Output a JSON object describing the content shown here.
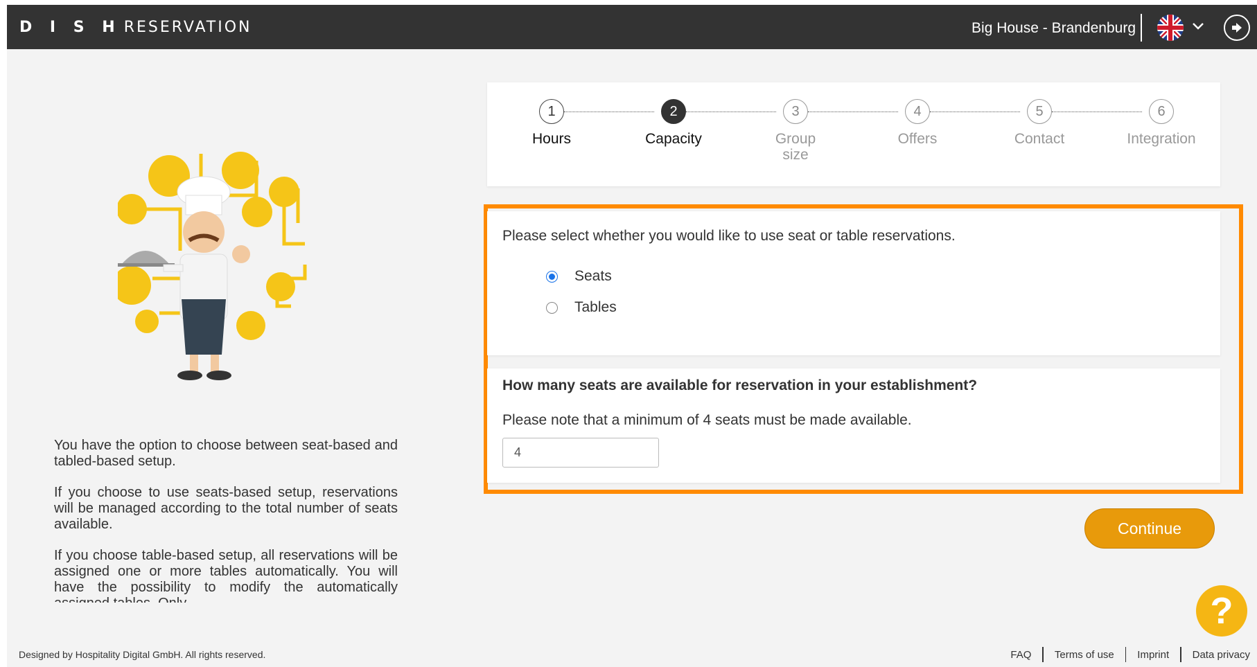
{
  "header": {
    "logo_bold": "D I S H",
    "logo_light": "RESERVATION",
    "venue": "Big House - Brandenburg"
  },
  "steps": [
    {
      "num": "1",
      "label": "Hours"
    },
    {
      "num": "2",
      "label": "Capacity"
    },
    {
      "num": "3",
      "label": "Group size"
    },
    {
      "num": "4",
      "label": "Offers"
    },
    {
      "num": "5",
      "label": "Contact"
    },
    {
      "num": "6",
      "label": "Integration"
    }
  ],
  "reservation_type": {
    "question": "Please select whether you would like to use seat or table reservations.",
    "options": [
      "Seats",
      "Tables"
    ],
    "selected": "Seats"
  },
  "seats": {
    "question": "How many seats are available for reservation in your establishment?",
    "note": "Please note that a minimum of 4 seats must be made available.",
    "value": "4"
  },
  "continue_label": "Continue",
  "help_label": "?",
  "info_text": [
    "You have the option to choose between seat-based and tabled-based setup.",
    "If you choose to use seats-based setup, reservations will be managed according to the total number of seats available.",
    "If you choose table-based setup, all reservations will be assigned one or more tables automatically. You will have the possibility to modify the automatically assigned tables. Only"
  ],
  "footer": {
    "copyright": "Designed by Hospitality Digital GmbH. All rights reserved.",
    "links": [
      "FAQ",
      "Terms of use",
      "Imprint",
      "Data privacy"
    ]
  }
}
